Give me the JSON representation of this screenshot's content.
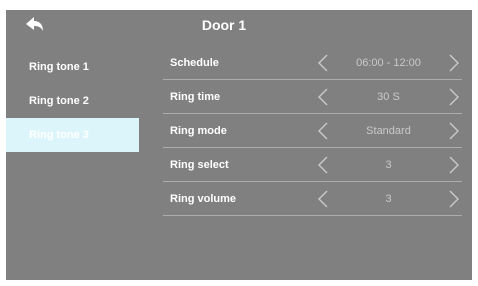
{
  "header": {
    "title": "Door 1",
    "back_icon": "back-arrow-icon"
  },
  "sidebar": {
    "items": [
      {
        "label": "Ring tone 1"
      },
      {
        "label": "Ring tone 2"
      },
      {
        "label": "Ring tone 3",
        "active": true
      }
    ]
  },
  "settings": {
    "rows": [
      {
        "label": "Schedule",
        "value": "06:00 - 12:00"
      },
      {
        "label": "Ring time",
        "value": "30 S"
      },
      {
        "label": "Ring mode",
        "value": "Standard"
      },
      {
        "label": "Ring select",
        "value": "3"
      },
      {
        "label": "Ring volume",
        "value": "3"
      }
    ]
  },
  "colors": {
    "background": "#808080",
    "active_item": "#dcf5fb",
    "text": "#ffffff",
    "value_text": "#c9c9c9"
  }
}
